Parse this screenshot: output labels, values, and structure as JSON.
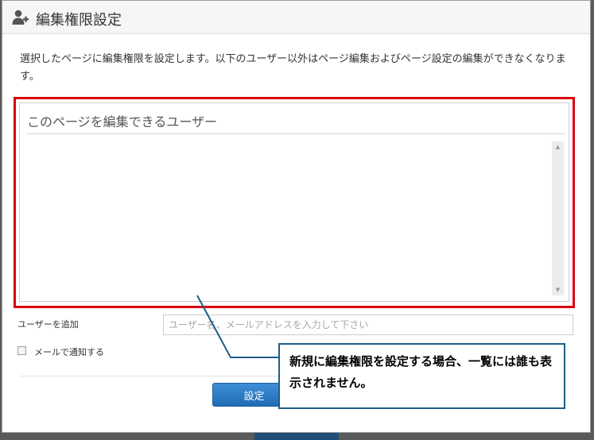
{
  "dialog": {
    "title": "編集権限設定",
    "description": "選択したページに編集権限を設定します。以下のユーザー以外はページ編集およびページ設定の編集ができなくなります。"
  },
  "users_panel": {
    "header": "このページを編集できるユーザー"
  },
  "add_user": {
    "label": "ユーザーを追加",
    "placeholder": "ユーザー名、メールアドレスを入力して下さい"
  },
  "notify": {
    "label": "メールで通知する",
    "checked": false
  },
  "submit": {
    "label": "設定"
  },
  "annotation": {
    "text": "新規に編集権限を設定する場合、一覧には誰も表示されません。"
  },
  "colors": {
    "highlight_frame": "#d9000d",
    "callout_border": "#1d5f86",
    "button": "#2a7bc6"
  },
  "icons": {
    "title": "user-add-icon"
  }
}
